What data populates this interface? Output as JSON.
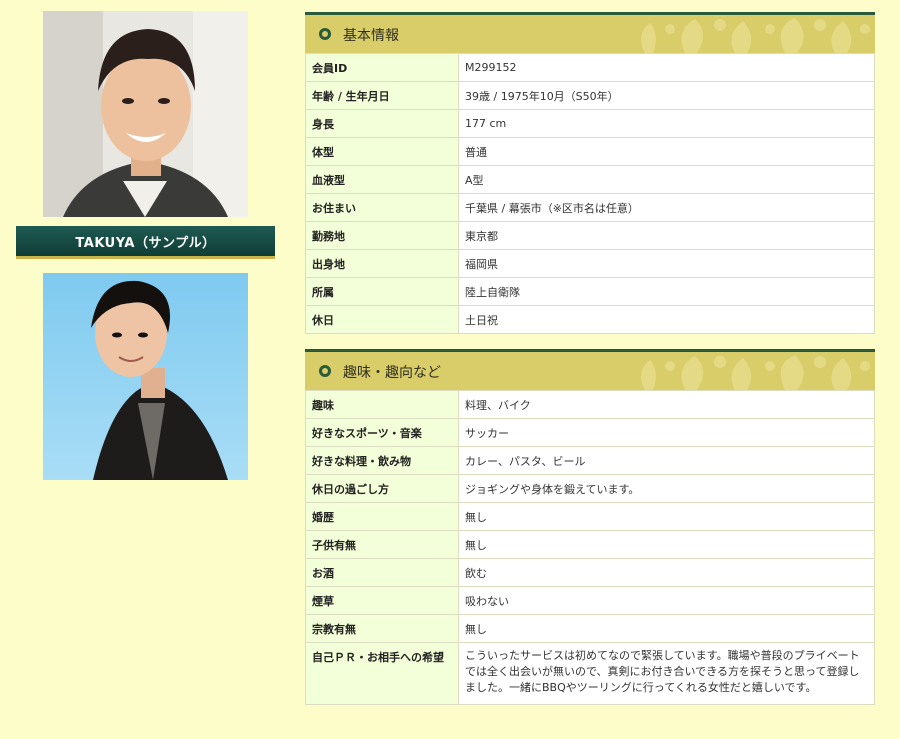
{
  "profile": {
    "name_label": "TAKUYA（サンプル）"
  },
  "basic": {
    "title": "基本情報",
    "rows": [
      {
        "key": "会員ID",
        "value": "M299152"
      },
      {
        "key": "年齢 / 生年月日",
        "value": "39歳 / 1975年10月（S50年）"
      },
      {
        "key": "身長",
        "value": "177 cm"
      },
      {
        "key": "体型",
        "value": "普通"
      },
      {
        "key": "血液型",
        "value": "A型"
      },
      {
        "key": "お住まい",
        "value": "千葉県 / 幕張市（※区市名は任意）"
      },
      {
        "key": "勤務地",
        "value": "東京都"
      },
      {
        "key": "出身地",
        "value": "福岡県"
      },
      {
        "key": "所属",
        "value": "陸上自衛隊"
      },
      {
        "key": "休日",
        "value": "土日祝"
      }
    ]
  },
  "hobby": {
    "title": "趣味・趣向など",
    "rows": [
      {
        "key": "趣味",
        "value": "料理、バイク"
      },
      {
        "key": "好きなスポーツ・音楽",
        "value": "サッカー"
      },
      {
        "key": "好きな料理・飲み物",
        "value": "カレー、パスタ、ビール"
      },
      {
        "key": "休日の過ごし方",
        "value": "ジョギングや身体を鍛えています。"
      },
      {
        "key": "婚歴",
        "value": "無し"
      },
      {
        "key": "子供有無",
        "value": "無し"
      },
      {
        "key": "お酒",
        "value": "飲む"
      },
      {
        "key": "煙草",
        "value": "吸わない"
      },
      {
        "key": "宗教有無",
        "value": "無し"
      },
      {
        "key": "自己ＰＲ・お相手への希望",
        "value": "こういったサービスは初めてなので緊張しています。職場や普段のプライベートでは全く出会いが無いので、真剣にお付き合いできる方を探そうと思って登録しました。一緒にBBQやツーリングに行ってくれる女性だと嬉しいです。"
      }
    ]
  },
  "colors": {
    "page_bg": "#fdfdc9",
    "header_bg": "#d9cd6a",
    "header_line": "#2a5a3b",
    "key_bg": "#f3ffd8",
    "nameplate_bg": "#1f5b52"
  }
}
